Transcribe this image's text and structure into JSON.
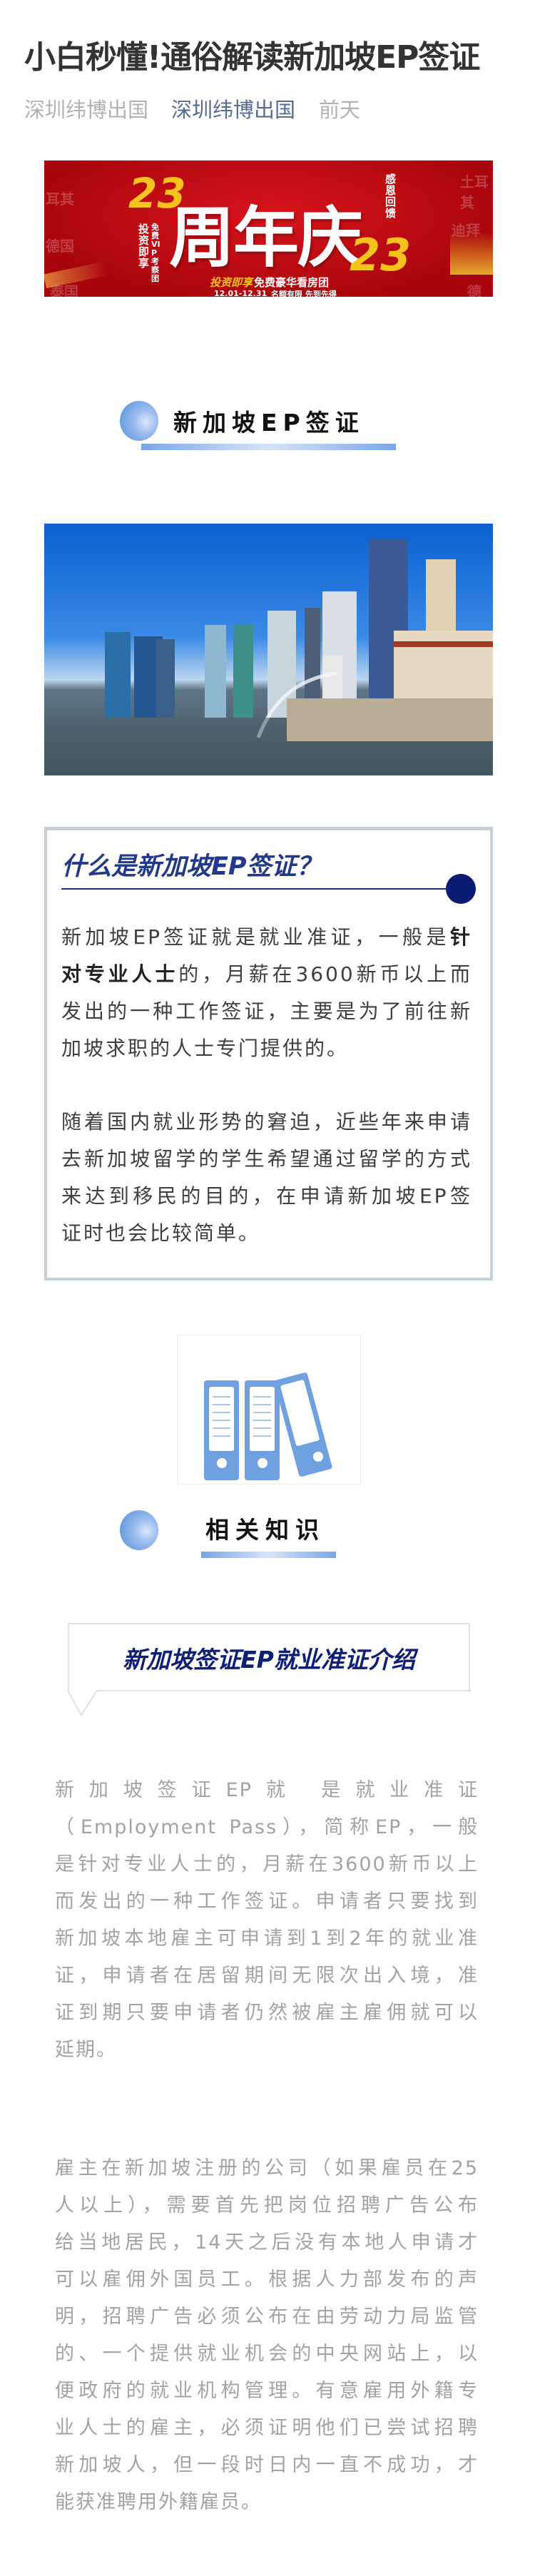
{
  "article": {
    "title": "小白秒懂!通俗解读新加坡EP签证",
    "meta": {
      "author": "深圳纬博出国",
      "account": "深圳纬博出国",
      "time": "前天"
    }
  },
  "banner": {
    "number": "23",
    "headline": "周年庆",
    "side_vertical": "感恩回馈",
    "vertical_1": "投资即享",
    "vertical_2": "免费VIP考察团",
    "slogan_a": "投资即享",
    "slogan_b": "免费豪华看房团",
    "dates": "12.01-12.31",
    "note": "名额有限 先到先得",
    "countries": [
      "耳其",
      "德国",
      "泰国",
      "土耳其",
      "迪拜",
      "德国"
    ]
  },
  "section1": {
    "heading": "新加坡EP签证"
  },
  "box": {
    "title": "什么是新加坡EP签证？",
    "p1": [
      [
        {
          "t": "新加坡EP签证就是就业准证，一般是"
        },
        {
          "t": "针",
          "b": true
        }
      ],
      [
        {
          "t": "对专业人士",
          "b": true
        },
        {
          "t": "的，月薪在3600新币以上而"
        }
      ],
      [
        {
          "t": "发出的一种工作签证，主要是为了前往新"
        }
      ],
      [
        {
          "t": "加坡求职的人士专门提供的。"
        }
      ]
    ],
    "p2": [
      "随着国内就业形势的窘迫，近些年来申请",
      "去新加坡留学的学生希望通过留学的方式",
      "来达到移民的目的，在申请新加坡EP签",
      "证时也会比较简单。"
    ]
  },
  "section2": {
    "heading": "相关知识"
  },
  "subheading": "新加坡签证EP就业准证介绍",
  "paragraphs": [
    [
      "新加坡签证EP就 是就业准证",
      "（Employment Pass），简称EP，一般",
      "是针对专业人士的，月薪在3600新币以上",
      "而发出的一种工作签证。申请者只要找到",
      "新加坡本地雇主可申请到1到2年的就业准",
      "证，申请者在居留期间无限次出入境，准",
      "证到期只要申请者仍然被雇主雇佣就可以",
      "延期。"
    ],
    [
      "雇主在新加坡注册的公司（如果雇员在25",
      "人以上），需要首先把岗位招聘广告公布",
      "给当地居民，14天之后没有本地人申请才",
      "可以雇佣外国员工。根据人力部发布的声",
      "明，招聘广告必须公布在由劳动力局监管",
      "的、一个提供就业机会的中央网站上，以",
      "便政府的就业机构管理。有意雇用外籍专",
      "业人士的雇主，必须证明他们已尝试招聘",
      "新加坡人，但一段时日内一直不成功，才",
      "能获准聘用外籍雇员。"
    ]
  ],
  "colors": {
    "link": "#576b95",
    "meta": "#b2b2b2",
    "accent": "#0b1a72",
    "icon": "#6fa0e0",
    "banner": "#c80d14"
  }
}
